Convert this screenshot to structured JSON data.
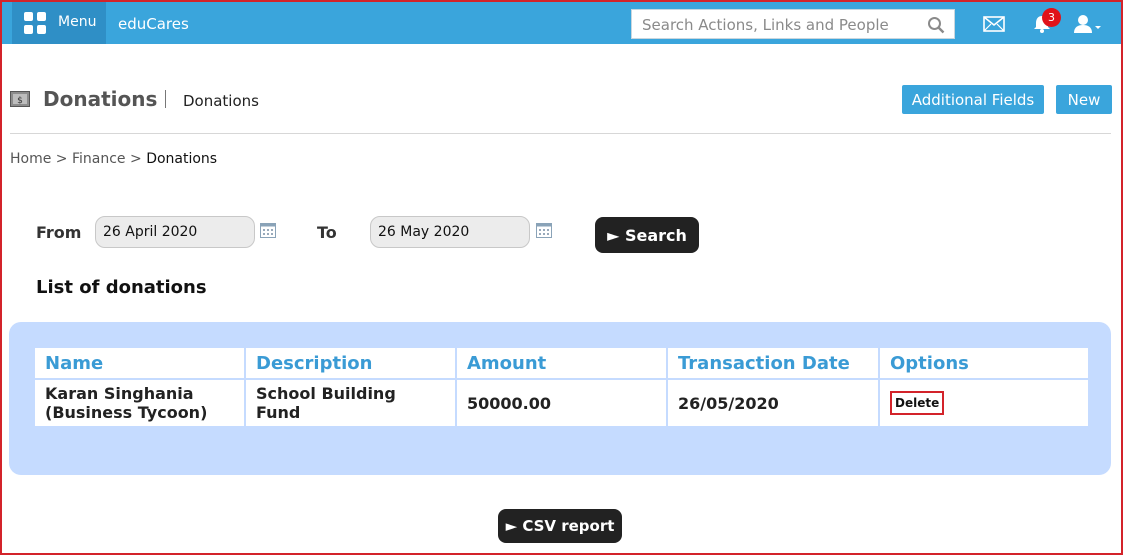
{
  "topbar": {
    "menu_label": "Menu",
    "brand": "eduCares",
    "search_placeholder": "Search Actions, Links and People",
    "notification_count": "3"
  },
  "header": {
    "title": "Donations",
    "subtitle": "Donations",
    "additional_fields_label": "Additional Fields",
    "new_label": "New"
  },
  "breadcrumb": {
    "home": "Home",
    "finance": "Finance",
    "current": "Donations",
    "separator": ">"
  },
  "filters": {
    "from_label": "From",
    "from_value": "26 April 2020",
    "to_label": "To",
    "to_value": "26 May 2020",
    "search_label": "► Search"
  },
  "list": {
    "title": "List of donations",
    "columns": [
      "Name",
      "Description",
      "Amount",
      "Transaction Date",
      "Options"
    ],
    "rows": [
      {
        "name_line1": "Karan Singhania",
        "name_line2": "(Business Tycoon)",
        "description": "School Building Fund",
        "amount": "50000.00",
        "date": "26/05/2020",
        "option": "Delete"
      }
    ]
  },
  "csv_label": "► CSV report",
  "colors": {
    "topbar": "#3aa5dc",
    "accent_text": "#3a9bd5",
    "panel": "#c5dbff",
    "highlight_border": "#d3232a"
  }
}
